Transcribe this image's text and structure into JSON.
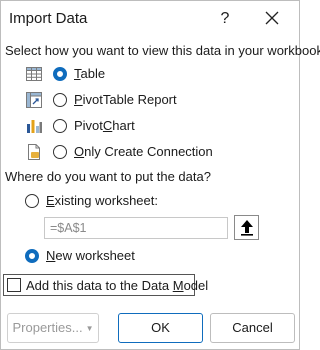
{
  "window": {
    "title": "Import Data",
    "help_glyph": "?",
    "close_icon": "close-icon"
  },
  "view_section": {
    "prompt": "Select how you want to view this data in your workbook.",
    "options": [
      {
        "pre": "",
        "mnemonic": "T",
        "post": "able",
        "icon": "table-icon",
        "checked": true
      },
      {
        "pre": "",
        "mnemonic": "P",
        "post": "ivotTable Report",
        "icon": "pivot-table-icon",
        "checked": false
      },
      {
        "pre": "Pivot",
        "mnemonic": "C",
        "post": "hart",
        "icon": "pivot-chart-icon",
        "checked": false
      },
      {
        "pre": "",
        "mnemonic": "O",
        "post": "nly Create Connection",
        "icon": "connection-icon",
        "checked": false
      }
    ]
  },
  "location_section": {
    "prompt": "Where do you want to put the data?",
    "existing": {
      "pre": "",
      "mnemonic": "E",
      "post": "xisting worksheet:",
      "checked": false
    },
    "reference_value": "=$A$1",
    "new": {
      "pre": "",
      "mnemonic": "N",
      "post": "ew worksheet",
      "checked": true
    }
  },
  "data_model": {
    "pre": "Add this data to the Data ",
    "mnemonic": "M",
    "post": "odel",
    "checked": false
  },
  "buttons": {
    "properties": "Properties...",
    "ok": "OK",
    "cancel": "Cancel"
  },
  "colors": {
    "accent": "#0f6cbd",
    "disabled_text": "#9a9a9a"
  }
}
